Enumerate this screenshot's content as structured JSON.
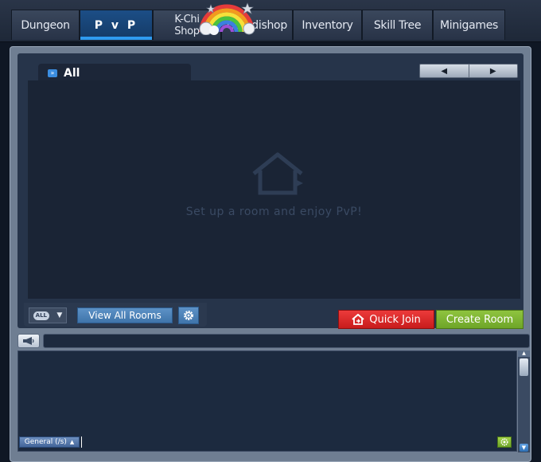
{
  "tabs": [
    {
      "label": "Dungeon",
      "active": false
    },
    {
      "label": "P v P",
      "active": true
    },
    {
      "label_line1": "K-Chi",
      "label_line2": "Shop",
      "active": false
    },
    {
      "label": "Coordishop",
      "active": false
    },
    {
      "label": "Inventory",
      "active": false
    },
    {
      "label": "Skill Tree",
      "active": false
    },
    {
      "label": "Minigames",
      "active": false
    }
  ],
  "room_list": {
    "filter_tab_label": "All",
    "pager": {
      "prev_icon": "left-triangle-icon",
      "next_icon": "right-triangle-icon"
    },
    "empty_message": "Set up a room and enjoy PvP!",
    "empty_icon": "house-icon"
  },
  "controls": {
    "room_filter_badge": "ALL",
    "view_all_rooms_label": "View All Rooms",
    "quick_join_label": "Quick Join",
    "create_room_label": "Create Room"
  },
  "chat": {
    "channel_label": "General (/s)",
    "input_value": ""
  },
  "colors": {
    "active_tab": "#1c4e86",
    "quick_join": "#d82828",
    "create_room": "#7cb534",
    "view_button": "#4f84b9",
    "panel_bg": "#6f7e92",
    "room_area": "#1a2435"
  }
}
